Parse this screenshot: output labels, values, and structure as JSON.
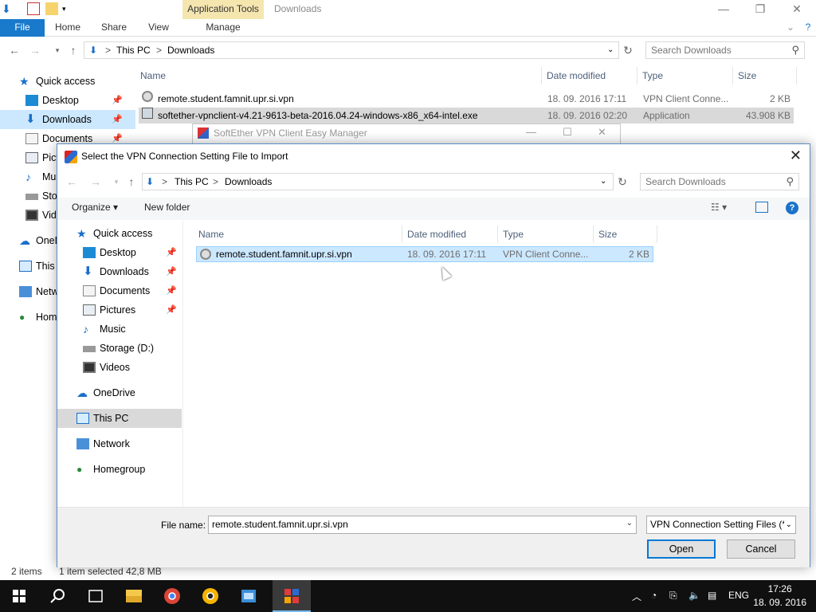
{
  "explorer": {
    "context_tab": "Application Tools",
    "title": "Downloads",
    "ribbon_tabs": {
      "file": "File",
      "home": "Home",
      "share": "Share",
      "view": "View",
      "manage": "Manage"
    },
    "address": {
      "pc": "This PC",
      "sep": ">",
      "folder": "Downloads"
    },
    "search_placeholder": "Search Downloads",
    "nav": {
      "quick_access": "Quick access",
      "desktop": "Desktop",
      "downloads": "Downloads",
      "documents": "Documents",
      "pictures": "Pict",
      "music": "Mu",
      "storage": "Sto",
      "videos": "Vid",
      "onedrive": "OneD",
      "this_pc": "This",
      "network": "Netw",
      "homegroup": "Hom"
    },
    "columns": {
      "name": "Name",
      "date": "Date modified",
      "type": "Type",
      "size": "Size"
    },
    "files": [
      {
        "name": "remote.student.famnit.upr.si.vpn",
        "date": "18. 09. 2016 17:11",
        "type": "VPN Client Conne...",
        "size": "2 KB"
      },
      {
        "name": "softether-vpnclient-v4.21-9613-beta-2016.04.24-windows-x86_x64-intel.exe",
        "date": "18. 09. 2016 02:20",
        "type": "Application",
        "size": "43.908 KB"
      }
    ],
    "status": {
      "items": "2 items",
      "selected": "1 item selected  42,8 MB"
    }
  },
  "softether": {
    "title": "SoftEther VPN Client Easy Manager"
  },
  "dialog": {
    "title": "Select the VPN Connection Setting File to Import",
    "address": {
      "pc": "This PC",
      "sep": ">",
      "folder": "Downloads"
    },
    "search_placeholder": "Search Downloads",
    "toolbar": {
      "organize": "Organize ▾",
      "new_folder": "New folder"
    },
    "nav": {
      "quick_access": "Quick access",
      "desktop": "Desktop",
      "downloads": "Downloads",
      "documents": "Documents",
      "pictures": "Pictures",
      "music": "Music",
      "storage": "Storage (D:)",
      "videos": "Videos",
      "onedrive": "OneDrive",
      "this_pc": "This PC",
      "network": "Network",
      "homegroup": "Homegroup"
    },
    "columns": {
      "name": "Name",
      "date": "Date modified",
      "type": "Type",
      "size": "Size"
    },
    "file": {
      "name": "remote.student.famnit.upr.si.vpn",
      "date": "18. 09. 2016 17:11",
      "type": "VPN Client Conne...",
      "size": "2 KB"
    },
    "file_name_label": "File name:",
    "file_name_value": "remote.student.famnit.upr.si.vpn",
    "file_type": "VPN Connection Setting Files (*",
    "open_label": "Open",
    "cancel_label": "Cancel"
  },
  "taskbar": {
    "language": "ENG",
    "time": "17:26",
    "date": "18. 09. 2016"
  },
  "colors": {
    "accent": "#0078d7",
    "file_tab": "#1979ca",
    "selection": "#cce8ff",
    "context_tab": "#f5e6b0"
  }
}
